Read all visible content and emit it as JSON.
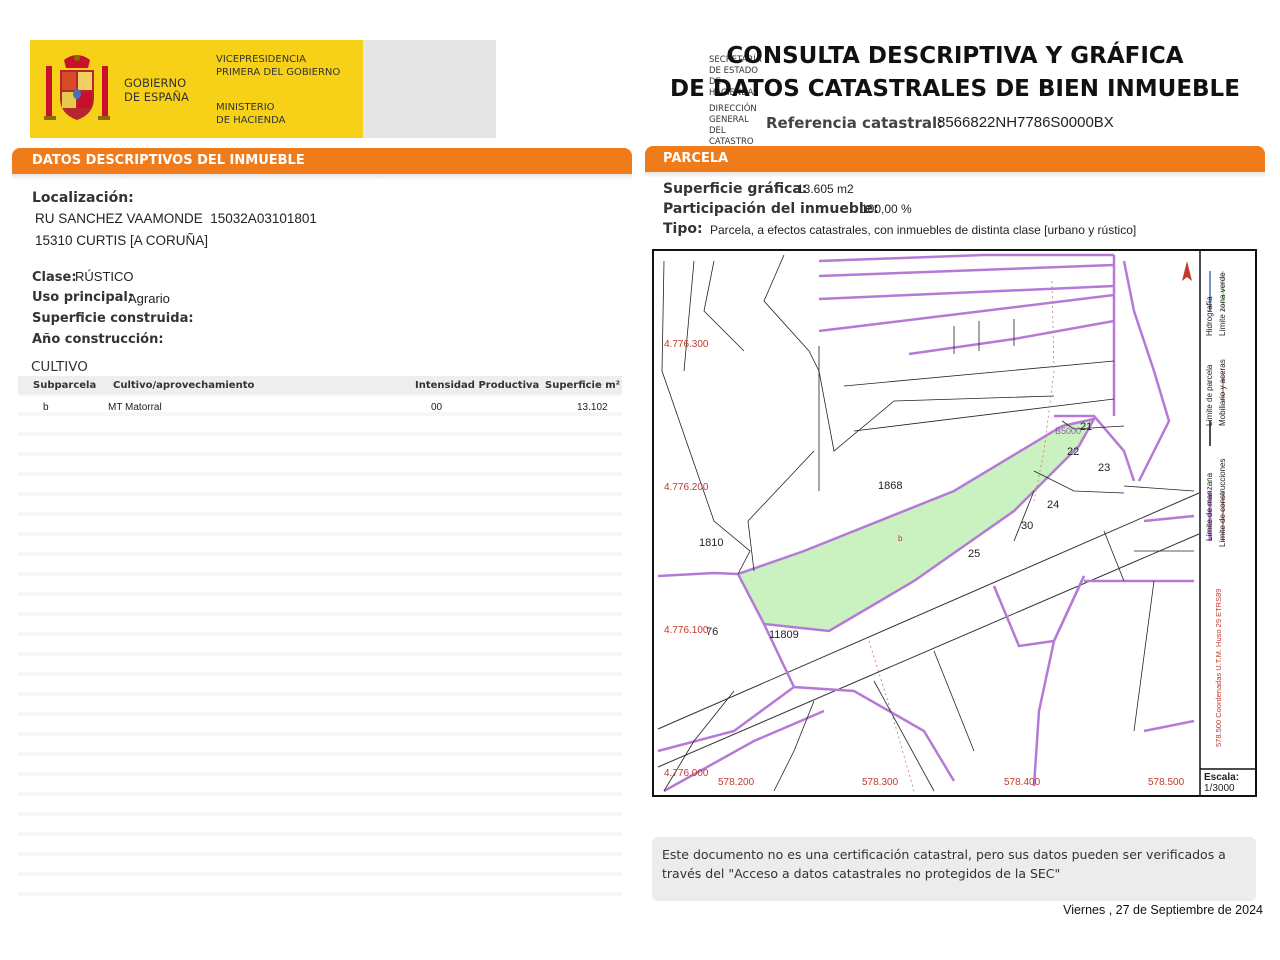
{
  "header": {
    "gobierno": "GOBIERNO DE ESPAÑA",
    "vicepresidencia": "VICEPRESIDENCIA PRIMERA DEL GOBIERNO",
    "ministerio": "MINISTERIO DE HACIENDA",
    "secretaria": "SECRETARÍA DE ESTADO DE HACIENDA",
    "direccion": "DIRECCIÓN GENERAL DEL CATASTRO",
    "title_line1": "CONSULTA DESCRIPTIVA Y GRÁFICA",
    "title_line2": "DE DATOS CATASTRALES DE BIEN INMUEBLE",
    "ref_label": "Referencia catastral:",
    "ref_value": "8566822NH7786S0000BX"
  },
  "left": {
    "section_title": "DATOS DESCRIPTIVOS DEL INMUEBLE",
    "localizacion_label": "Localización:",
    "localizacion_line1": "RU SANCHEZ VAAMONDE  15032A03101801",
    "localizacion_line2": "15310 CURTIS [A CORUÑA]",
    "clase_label": "Clase:",
    "clase_value": "RÚSTICO",
    "uso_label": "Uso principal:",
    "uso_value": "Agrario",
    "superficie_label": "Superficie construida:",
    "anio_label": "Año construcción:",
    "cultivo_title": "CULTIVO",
    "table": {
      "headers": [
        "Subparcela",
        "Cultivo/aprovechamiento",
        "Intensidad Productiva",
        "Superficie m²"
      ],
      "rows": [
        [
          "b",
          "MT Matorral",
          "00",
          "13.102"
        ]
      ]
    }
  },
  "right": {
    "section_title": "PARCELA",
    "sup_grafica_label": "Superficie gráfica:",
    "sup_grafica_value": "13.605 m2",
    "participacion_label": "Participación del inmueble:",
    "participacion_value": "100,00 %",
    "tipo_label": "Tipo:",
    "tipo_value": "Parcela, a efectos catastrales, con inmuebles de distinta clase [urbano y rústico]"
  },
  "map": {
    "y_coords": [
      "4.776.300",
      "4.776.200",
      "4.776.100",
      "4.776.000"
    ],
    "x_coords": [
      "578.200",
      "578.300",
      "578.400",
      "578.500"
    ],
    "labels": {
      "p1868": "1868",
      "p1810": "1810",
      "p11809": "11809",
      "p76": "76",
      "p21": "21",
      "p22": "22",
      "p23": "23",
      "p24": "24",
      "p25": "25",
      "p30": "30",
      "sub_b": "b",
      "code": "B5000"
    },
    "legend": {
      "manzana": "Límite de manzana",
      "parcela": "Límite de parcela",
      "hidrografia": "Hidrografía",
      "construcciones": "Límite de construcciones",
      "mobiliario": "Mobiliario y aceras",
      "zona_verde": "Límite zona verde",
      "coords": "578.500 Coordenadas U.T.M. Huso 29 ETRS89"
    },
    "scale_label": "Escala:",
    "scale_value": "1/3000",
    "colors": {
      "parcel_fill": "#c9f2c0",
      "manzana": "#b57ad6",
      "coords_text": "#c0392b"
    }
  },
  "footer": {
    "disclaimer": "Este documento no es una certificación catastral, pero sus datos pueden ser verificados a través del \"Acceso a datos catastrales no protegidos de la SEC\"",
    "date": "Viernes , 27 de Septiembre de 2024"
  }
}
